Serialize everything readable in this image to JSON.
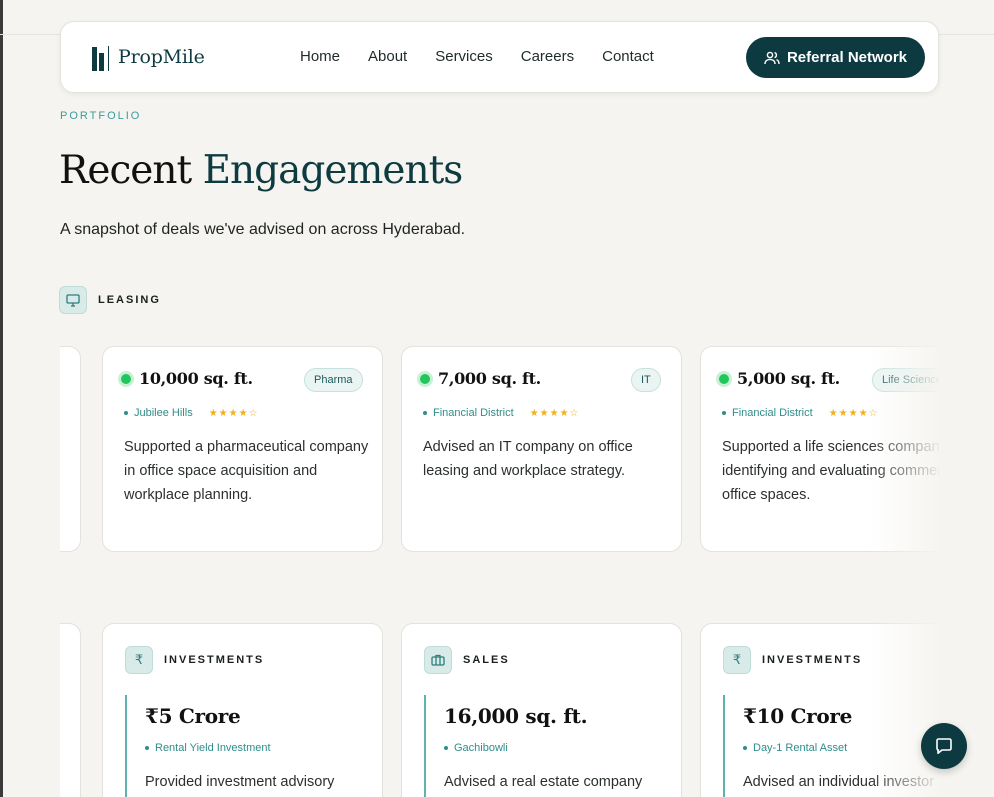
{
  "nav": {
    "logo_text": "PropMile",
    "links": [
      "Home",
      "About",
      "Services",
      "Careers",
      "Contact"
    ],
    "cta_label": "Referral Network"
  },
  "header": {
    "eyebrow": "PORTFOLIO",
    "title_part1": "Recent ",
    "title_part2": "Engagements",
    "subtitle": "A snapshot of deals we've advised on across Hyderabad."
  },
  "leasing": {
    "section_label": "LEASING",
    "cards": [
      {
        "value": "10,000 sq. ft.",
        "tag": "Pharma",
        "location": "Jubilee Hills",
        "stars": "★★★★☆",
        "description": "Supported a pharmaceutical company in office space acquisition and workplace planning."
      },
      {
        "value": "7,000 sq. ft.",
        "tag": "IT",
        "location": "Financial District",
        "stars": "★★★★☆",
        "description": "Advised an IT company on office leasing and workplace strategy."
      },
      {
        "value": "5,000 sq. ft.",
        "tag": "Life Sciences",
        "location": "Financial District",
        "stars": "★★★★☆",
        "description": "Supported a life sciences company in identifying and evaluating commercial office spaces."
      }
    ]
  },
  "deals": {
    "cards": [
      {
        "category": "INVESTMENTS",
        "icon": "rupee-icon",
        "value": "₹5 Crore",
        "meta": "Rental Yield Investment",
        "description": "Provided investment advisory"
      },
      {
        "category": "SALES",
        "icon": "briefcase-icon",
        "value": "16,000 sq. ft.",
        "meta": "Gachibowli",
        "description": "Advised a real estate company"
      },
      {
        "category": "INVESTMENTS",
        "icon": "rupee-icon",
        "value": "₹10 Crore",
        "meta": "Day-1 Rental Asset",
        "description": "Advised an individual investor"
      }
    ]
  },
  "icons": {
    "leasing": "monitor-icon",
    "rupee_glyph": "₹",
    "cta": "users-icon",
    "chat": "chat-icon"
  },
  "colors": {
    "brand": "#0d3a40",
    "accent_teal": "#3b9b9a",
    "status_green": "#22c55e",
    "star": "#f2b01e"
  }
}
